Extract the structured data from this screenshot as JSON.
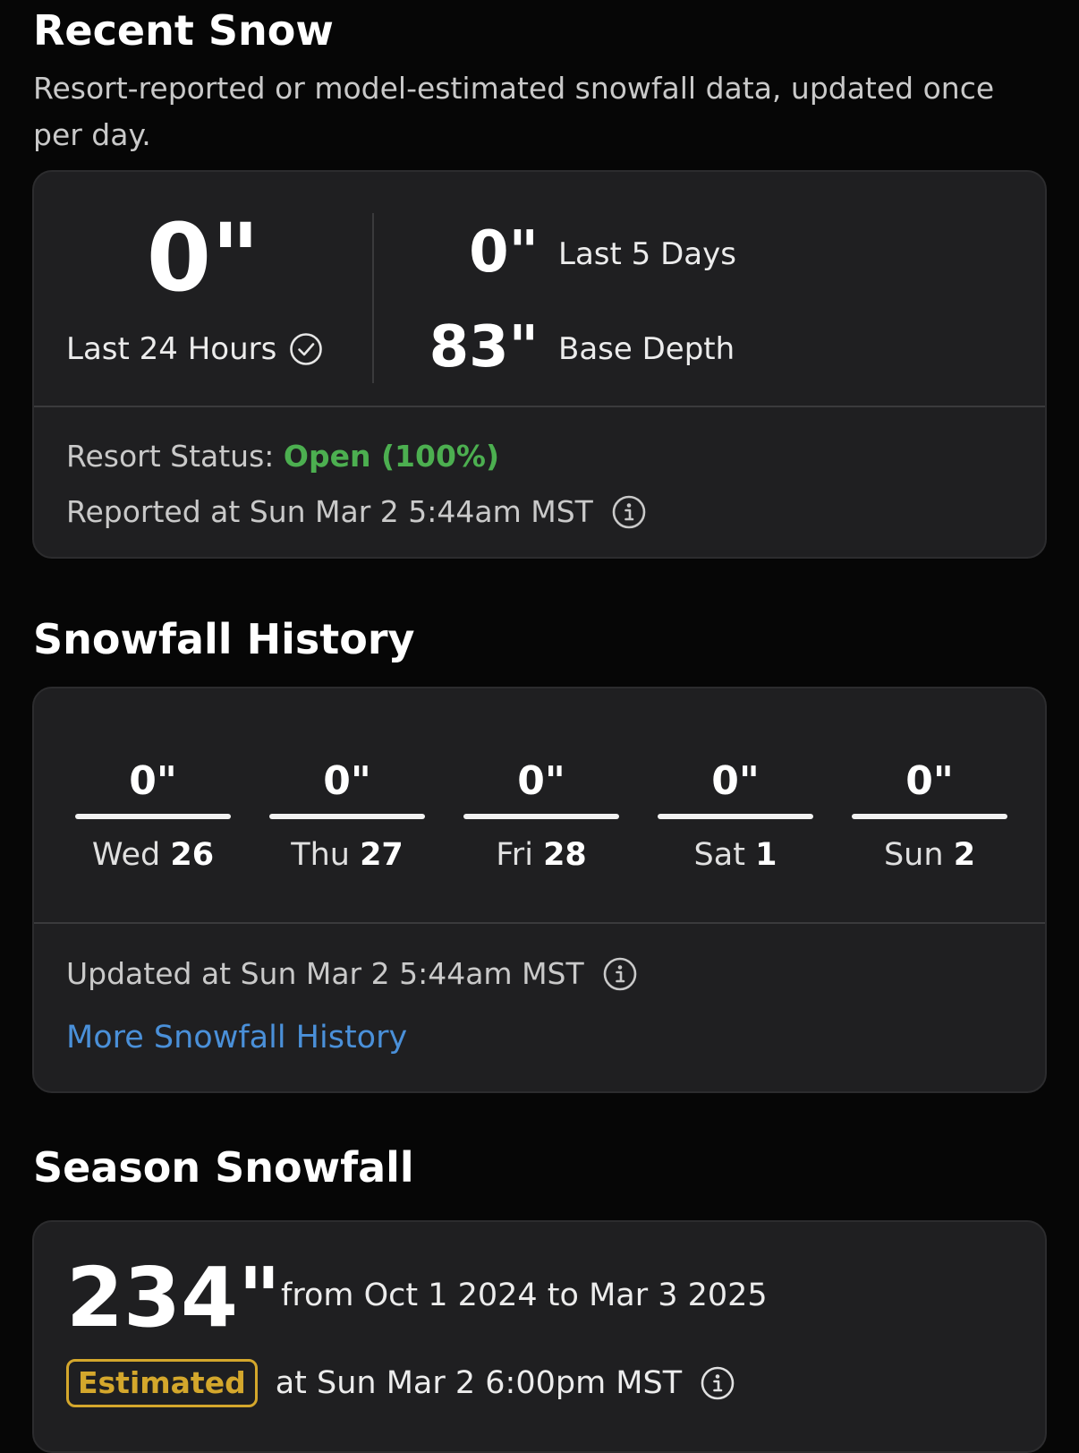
{
  "recent_snow": {
    "title": "Recent Snow",
    "subtitle": "Resort-reported or model-estimated snowfall data, updated once per day.",
    "last24_value": "0\"",
    "last24_label": "Last 24 Hours",
    "last5_value": "0\"",
    "last5_label": "Last 5 Days",
    "base_value": "83\"",
    "base_label": "Base Depth",
    "status_label": "Resort Status:",
    "status_value": "Open (100%)",
    "reported": "Reported at Sun Mar 2 5:44am MST",
    "status_color": "#4caf50"
  },
  "snowfall_history": {
    "title": "Snowfall History",
    "days": [
      {
        "value": "0\"",
        "dow": "Wed",
        "date": "26"
      },
      {
        "value": "0\"",
        "dow": "Thu",
        "date": "27"
      },
      {
        "value": "0\"",
        "dow": "Fri",
        "date": "28"
      },
      {
        "value": "0\"",
        "dow": "Sat",
        "date": "1"
      },
      {
        "value": "0\"",
        "dow": "Sun",
        "date": "2"
      }
    ],
    "updated": "Updated at Sun Mar 2 5:44am MST",
    "more_link": "More Snowfall History",
    "link_color": "#4a90d9"
  },
  "season_snowfall": {
    "title": "Season Snowfall",
    "total": "234\"",
    "range": "from Oct 1 2024 to Mar 3 2025",
    "badge": "Estimated",
    "estimated_at": "at Sun Mar 2 6:00pm MST",
    "badge_color": "#d4a72c"
  },
  "icons": {
    "verified": "check-circle-icon",
    "info": "info-circle-icon"
  }
}
